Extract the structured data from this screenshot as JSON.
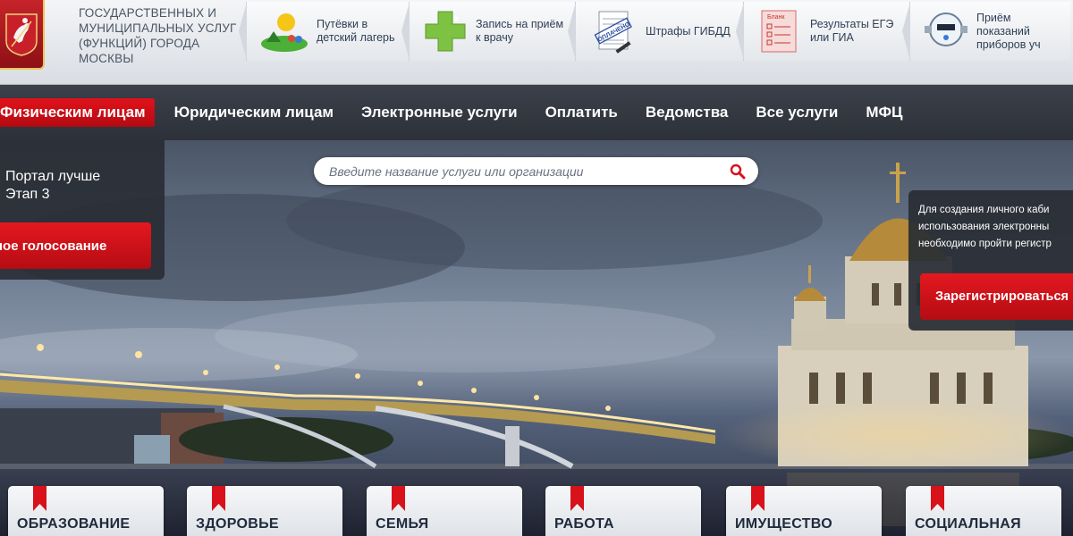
{
  "header": {
    "org_title": "ГОСУДАРСТВЕННЫХ И МУНИЦИПАЛЬНЫХ УСЛУГ (ФУНКЦИЙ) ГОРОДА МОСКВЫ",
    "quick_links": [
      {
        "label": "Путёвки в детский лагерь",
        "icon": "summer-camp-icon"
      },
      {
        "label": "Запись на приём к врачу",
        "icon": "medical-cross-icon"
      },
      {
        "label": "Штрафы ГИБДД",
        "icon": "paid-fine-document-icon",
        "icon_text": "ОПЛАЧЕНО"
      },
      {
        "label": "Результаты ЕГЭ или ГИА",
        "icon": "exam-form-icon",
        "icon_text": "Бланк"
      },
      {
        "label": "Приём показаний приборов уч",
        "icon": "water-meter-icon"
      }
    ]
  },
  "nav": {
    "items": [
      {
        "label": "Физическим лицам",
        "active": true
      },
      {
        "label": "Юридическим лицам"
      },
      {
        "label": "Электронные услуги"
      },
      {
        "label": "Оплатить"
      },
      {
        "label": "Ведомства"
      },
      {
        "label": "Все услуги"
      },
      {
        "label": "МФЦ"
      }
    ]
  },
  "poll": {
    "text_line1": "Портал лучше",
    "text_line2": "Этап 3",
    "button_label": "ное голосование"
  },
  "search": {
    "placeholder": "Введите название услуги или организации",
    "icon": "search-icon"
  },
  "registration": {
    "text_line1": "Для создания личного каби",
    "text_line2": "использования электронны",
    "text_line3": "необходимо пройти регистр",
    "button_label": "Зарегистрироваться"
  },
  "categories": [
    {
      "label": "ОБРАЗОВАНИЕ"
    },
    {
      "label": "ЗДОРОВЬЕ"
    },
    {
      "label": "СЕМЬЯ"
    },
    {
      "label": "РАБОТА"
    },
    {
      "label": "ИМУЩЕСТВО"
    },
    {
      "label": "СОЦИАЛЬНАЯ"
    }
  ],
  "colors": {
    "accent_red": "#d8111a",
    "nav_bg": "#353a43",
    "header_bg": "#e7e9ed"
  }
}
